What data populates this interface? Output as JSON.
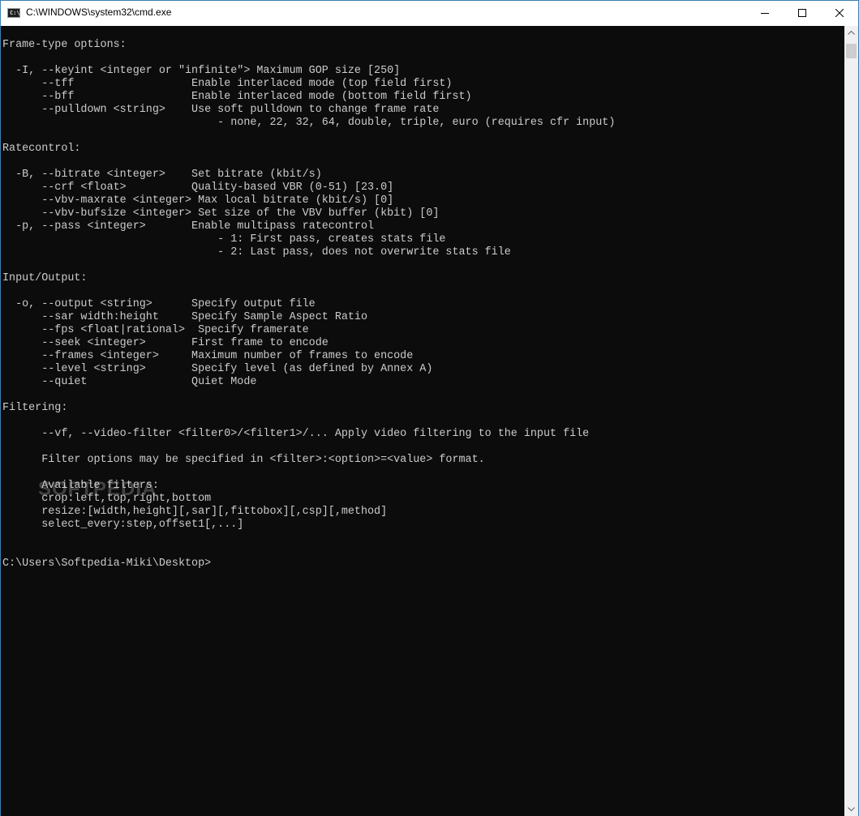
{
  "window": {
    "title": "C:\\WINDOWS\\system32\\cmd.exe",
    "icon_text": "C:\\"
  },
  "console": {
    "lines": [
      "",
      "Frame-type options:",
      "",
      "  -I, --keyint <integer or \"infinite\"> Maximum GOP size [250]",
      "      --tff                  Enable interlaced mode (top field first)",
      "      --bff                  Enable interlaced mode (bottom field first)",
      "      --pulldown <string>    Use soft pulldown to change frame rate",
      "                                 - none, 22, 32, 64, double, triple, euro (requires cfr input)",
      "",
      "Ratecontrol:",
      "",
      "  -B, --bitrate <integer>    Set bitrate (kbit/s)",
      "      --crf <float>          Quality-based VBR (0-51) [23.0]",
      "      --vbv-maxrate <integer> Max local bitrate (kbit/s) [0]",
      "      --vbv-bufsize <integer> Set size of the VBV buffer (kbit) [0]",
      "  -p, --pass <integer>       Enable multipass ratecontrol",
      "                                 - 1: First pass, creates stats file",
      "                                 - 2: Last pass, does not overwrite stats file",
      "",
      "Input/Output:",
      "",
      "  -o, --output <string>      Specify output file",
      "      --sar width:height     Specify Sample Aspect Ratio",
      "      --fps <float|rational>  Specify framerate",
      "      --seek <integer>       First frame to encode",
      "      --frames <integer>     Maximum number of frames to encode",
      "      --level <string>       Specify level (as defined by Annex A)",
      "      --quiet                Quiet Mode",
      "",
      "Filtering:",
      "",
      "      --vf, --video-filter <filter0>/<filter1>/... Apply video filtering to the input file",
      "",
      "      Filter options may be specified in <filter>:<option>=<value> format.",
      "",
      "      Available filters:",
      "      crop:left,top,right,bottom",
      "      resize:[width,height][,sar][,fittobox][,csp][,method]",
      "      select_every:step,offset1[,...]",
      "",
      "",
      "C:\\Users\\Softpedia-Miki\\Desktop>"
    ]
  },
  "watermark": "SOFTPEDIA",
  "colors": {
    "console_bg": "#0c0c0c",
    "console_fg": "#cccccc",
    "titlebar_bg": "#ffffff",
    "window_border": "#3c7fb1"
  }
}
